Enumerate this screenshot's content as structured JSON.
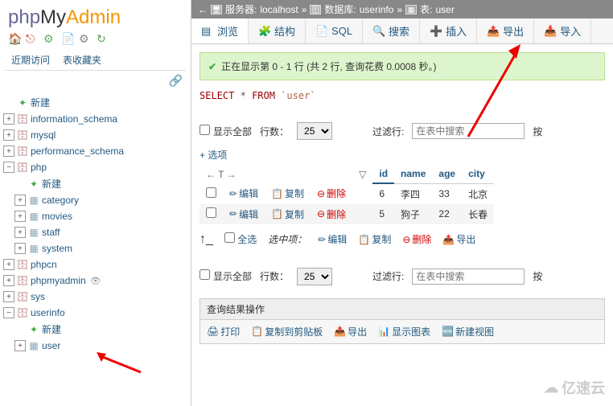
{
  "logo": {
    "php": "php",
    "my": "My",
    "admin": "Admin"
  },
  "nav_tabs": {
    "recent": "近期访问",
    "favorites": "表收藏夹"
  },
  "tree": {
    "new": "新建",
    "dbs": [
      {
        "name": "information_schema"
      },
      {
        "name": "mysql"
      },
      {
        "name": "performance_schema"
      },
      {
        "name": "php",
        "expanded": true,
        "children": [
          {
            "new": "新建"
          },
          {
            "name": "category"
          },
          {
            "name": "movies"
          },
          {
            "name": "staff"
          },
          {
            "name": "system"
          }
        ]
      },
      {
        "name": "phpcn"
      },
      {
        "name": "phpmyadmin",
        "eye": true
      },
      {
        "name": "sys"
      },
      {
        "name": "userinfo",
        "expanded": true,
        "children": [
          {
            "new": "新建"
          },
          {
            "name": "user"
          }
        ]
      }
    ]
  },
  "breadcrumb": {
    "server_label": "服务器:",
    "server": "localhost",
    "db_label": "数据库:",
    "db": "userinfo",
    "table_label": "表:",
    "table": "user"
  },
  "toolbar": {
    "browse": "浏览",
    "structure": "结构",
    "sql": "SQL",
    "search": "搜索",
    "insert": "插入",
    "export": "导出",
    "import": "导入"
  },
  "success": "正在显示第 0 - 1 行 (共 2 行, 查询花费 0.0008 秒。)",
  "sql": {
    "select": "SELECT",
    "star": "*",
    "from": "FROM",
    "table": "`user`"
  },
  "controls": {
    "show_all": "显示全部",
    "rows": "行数：",
    "rows_val": "25",
    "filter": "过滤行:",
    "search_ph": "在表中搜索",
    "by": "按"
  },
  "options": "+ 选项",
  "columns": {
    "id": "id",
    "name": "name",
    "age": "age",
    "city": "city"
  },
  "actions": {
    "edit": "编辑",
    "copy": "复制",
    "delete": "删除"
  },
  "rows": [
    {
      "id": "6",
      "name": "李四",
      "age": "33",
      "city": "北京"
    },
    {
      "id": "5",
      "name": "狗子",
      "age": "22",
      "city": "长春"
    }
  ],
  "bulk": {
    "select_all": "全选",
    "with_selected": "选中项：",
    "edit": "编辑",
    "copy": "复制",
    "delete": "删除",
    "export": "导出"
  },
  "results_ops": {
    "title": "查询结果操作",
    "print": "打印",
    "clipboard": "复制到剪贴板",
    "export": "导出",
    "chart": "显示图表",
    "view": "新建视图"
  },
  "watermark": "亿速云"
}
